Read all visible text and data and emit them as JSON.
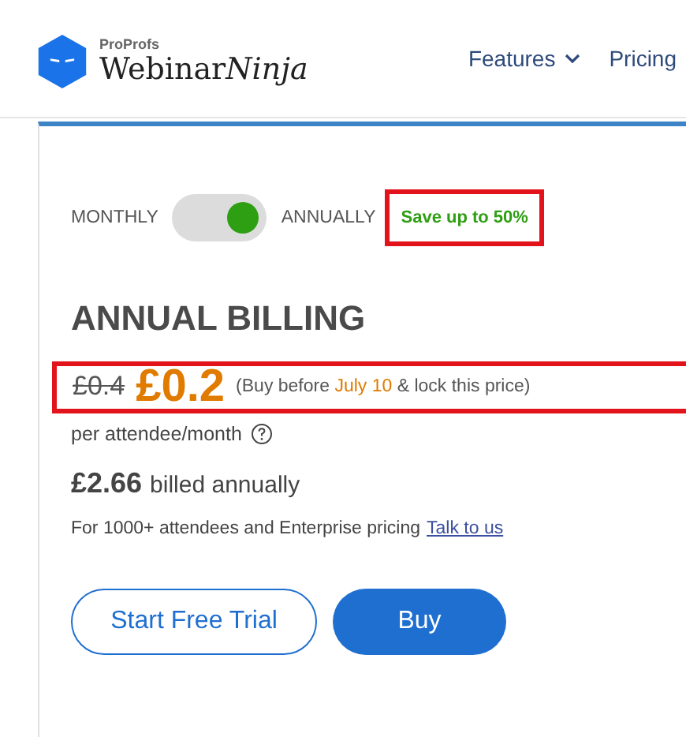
{
  "header": {
    "brand_small": "ProProfs",
    "brand_main": "Webinar",
    "brand_italic": "Ninja",
    "nav": [
      {
        "label": "Features",
        "dropdown": true
      },
      {
        "label": "Pricing",
        "dropdown": false
      }
    ]
  },
  "billing_toggle": {
    "left_label": "MONTHLY",
    "right_label": "ANNUALLY",
    "on": true,
    "badge": "Save up to 50%",
    "badge_highlighted": true
  },
  "plan": {
    "title": "ANNUAL BILLING",
    "old_price": "£0.4",
    "price": "£0.2",
    "price_note": "(Buy before **July 10** & lock this price)",
    "price_highlighted": true,
    "unit": "per attendee/month",
    "total": "£2.66",
    "total_note": "billed annually",
    "enterprise_text": "For 1000+ attendees and Enterprise pricing",
    "enterprise_link": "Talk to us"
  },
  "buttons": [
    {
      "label": "Start Free Trial",
      "kind": "outline"
    },
    {
      "label": "Buy",
      "kind": "filled"
    }
  ]
}
